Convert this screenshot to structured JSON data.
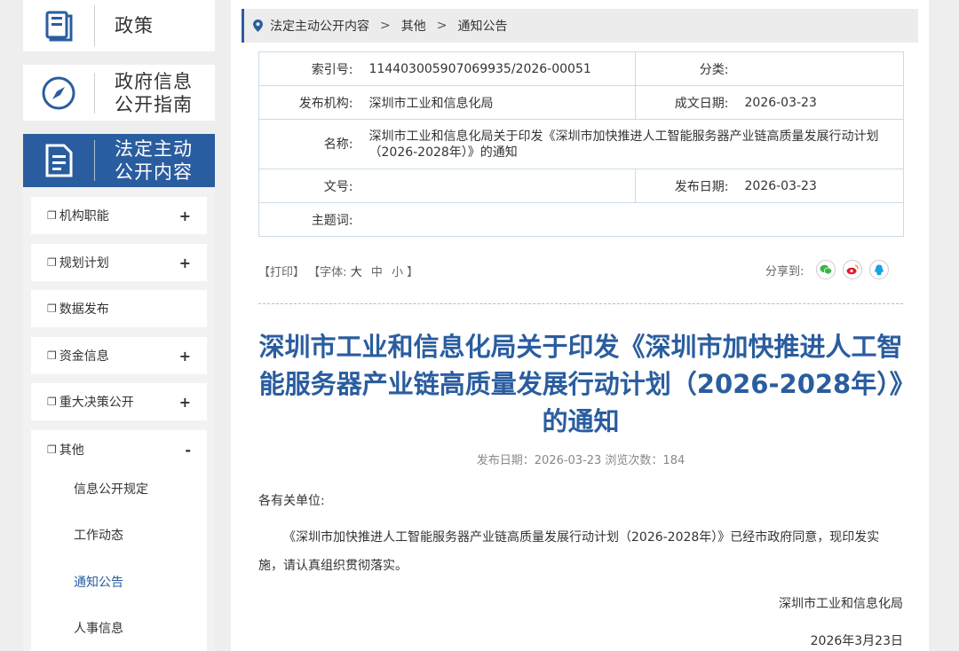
{
  "sidebar": {
    "categories": [
      {
        "label": "政策",
        "icon": "book-icon"
      },
      {
        "label": "政府信息公开指南",
        "label_line1": "政府信息",
        "label_line2": "公开指南",
        "icon": "compass-icon"
      },
      {
        "label": "法定主动公开内容",
        "label_line1": "法定主动",
        "label_line2": "公开内容",
        "icon": "document-icon"
      }
    ],
    "menu": [
      {
        "label": "机构职能",
        "sign": "+"
      },
      {
        "label": "规划计划",
        "sign": "+"
      },
      {
        "label": "数据发布",
        "sign": ""
      },
      {
        "label": "资金信息",
        "sign": "+"
      },
      {
        "label": "重大决策公开",
        "sign": "+"
      },
      {
        "label": "其他",
        "sign": "-"
      }
    ],
    "submenu": [
      "信息公开规定",
      "工作动态",
      "通知公告",
      "人事信息"
    ],
    "current_sub": "通知公告",
    "doc_icon_char": "❐"
  },
  "breadcrumb": [
    "法定主动公开内容",
    "其他",
    "通知公告"
  ],
  "meta": {
    "index_key": "索引号:",
    "index_val": "114403005907069935/2026-00051",
    "category_key": "分类:",
    "category_val": "",
    "publisher_key": "发布机构:",
    "publisher_val": "深圳市工业和信息化局",
    "created_key": "成文日期:",
    "created_val": "2026-03-23",
    "name_key": "名称:",
    "name_val": "深圳市工业和信息化局关于印发《深圳市加快推进人工智能服务器产业链高质量发展行动计划（2026-2028年）》的通知",
    "docno_key": "文号:",
    "docno_val": "",
    "pubdate_key": "发布日期:",
    "pubdate_val": "2026-03-23",
    "subject_key": "主题词:",
    "subject_val": ""
  },
  "tools": {
    "print": "【打印】",
    "font_prefix": "【字体:",
    "large": "大",
    "medium": "中",
    "small": "小",
    "font_suffix": "】",
    "share_label": "分享到:"
  },
  "article": {
    "title": "深圳市工业和信息化局关于印发《深圳市加快推进人工智能服务器产业链高质量发展行动计划（2026-2028年）》的通知",
    "pub_info": "发布日期：2026-03-23  浏览次数：184",
    "salutation": "各有关单位:",
    "paragraph": "《深圳市加快推进人工智能服务器产业链高质量发展行动计划（2026-2028年）》已经市政府同意，现印发实施，请认真组织贯彻落实。",
    "sign_org": "深圳市工业和信息化局",
    "sign_date": "2026年3月23日"
  },
  "colors": {
    "accent": "#2a5d9f",
    "wechat": "#3bb54a",
    "weibo": "#e6162d",
    "qq": "#1ba0e2"
  }
}
